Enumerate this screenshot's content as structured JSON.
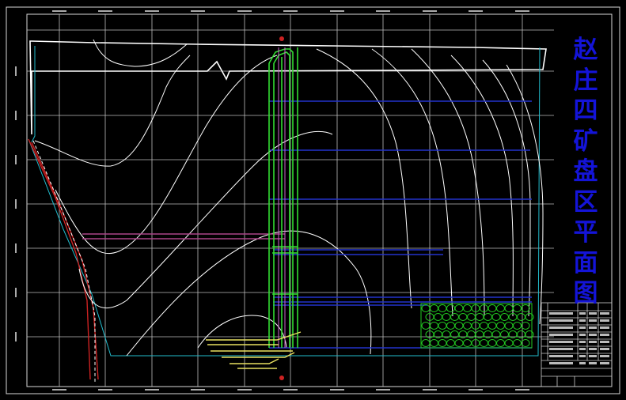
{
  "title_chars": [
    "赵",
    "庄",
    "四",
    "矿",
    "盘",
    "区",
    "平",
    "面",
    "图"
  ],
  "colors": {
    "background": "#000000",
    "grid": "#d8d8d8",
    "contour": "#ffffff",
    "roadway_green": "#33dd33",
    "roadway_blue": "#2233cc",
    "roadway_yellow": "#e8e060",
    "fault_red": "#cc2222",
    "boundary_cyan": "#22bbcc",
    "title_blue": "#1414d8",
    "goaf_fill": "#22cc22",
    "magenta": "#aa4488"
  }
}
